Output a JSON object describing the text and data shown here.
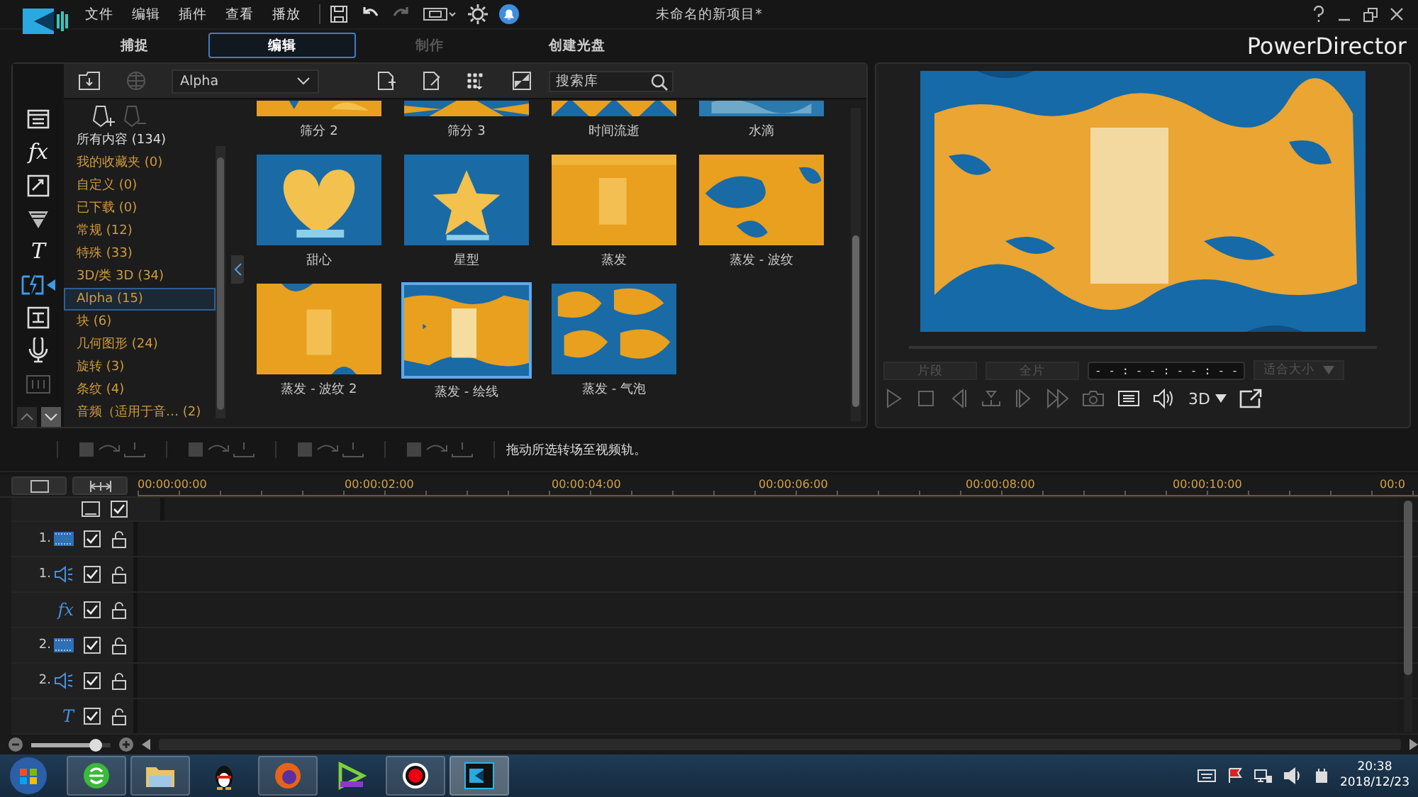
{
  "window": {
    "title": "未命名的新项目*",
    "app_name": "PowerDirector"
  },
  "menu": [
    "文件",
    "编辑",
    "插件",
    "查看",
    "播放"
  ],
  "mode_tabs": [
    {
      "label": "捕捉",
      "selected": false,
      "disabled": false
    },
    {
      "label": "编辑",
      "selected": true,
      "disabled": false
    },
    {
      "label": "制作",
      "selected": false,
      "disabled": true
    },
    {
      "label": "创建光盘",
      "selected": false,
      "disabled": false
    }
  ],
  "sidebar": [
    {
      "kind": "media",
      "selected": false
    },
    {
      "kind": "glyph",
      "glyph": "fx",
      "selected": false
    },
    {
      "kind": "pip",
      "selected": false
    },
    {
      "kind": "particle",
      "selected": false
    },
    {
      "kind": "glyph",
      "glyph": "T",
      "selected": false
    },
    {
      "kind": "transition",
      "selected": true
    },
    {
      "kind": "subtitle",
      "selected": false
    },
    {
      "kind": "mic",
      "selected": false
    },
    {
      "kind": "chapter",
      "selected": false
    }
  ],
  "library": {
    "category": "Alpha",
    "search": {
      "placeholder": "搜索库"
    },
    "categories": [
      {
        "label": "所有内容 (134)",
        "kind": "all",
        "selected": false
      },
      {
        "label": "我的收藏夹  (0)",
        "kind": "category",
        "selected": false
      },
      {
        "label": "自定义  (0)",
        "kind": "category",
        "selected": false
      },
      {
        "label": "已下载  (0)",
        "kind": "category",
        "selected": false
      },
      {
        "label": "常规  (12)",
        "kind": "category",
        "selected": false
      },
      {
        "label": "特殊  (33)",
        "kind": "category",
        "selected": false
      },
      {
        "label": "3D/类 3D  (34)",
        "kind": "category",
        "selected": false
      },
      {
        "label": "Alpha  (15)",
        "kind": "category",
        "selected": true
      },
      {
        "label": "块  (6)",
        "kind": "category",
        "selected": false
      },
      {
        "label": "几何图形  (24)",
        "kind": "category",
        "selected": false
      },
      {
        "label": "旋转  (3)",
        "kind": "category",
        "selected": false
      },
      {
        "label": "条纹  (4)",
        "kind": "category",
        "selected": false
      },
      {
        "label": "音频（适用于音…  (2)",
        "kind": "category",
        "selected": false
      }
    ],
    "items": [
      {
        "label": "筛分 2",
        "selected": false
      },
      {
        "label": "筛分 3",
        "selected": false
      },
      {
        "label": "时间流逝",
        "selected": false
      },
      {
        "label": "水滴",
        "selected": false
      },
      {
        "label": "甜心",
        "selected": false
      },
      {
        "label": "星型",
        "selected": false
      },
      {
        "label": "蒸发",
        "selected": false
      },
      {
        "label": "蒸发 - 波纹",
        "selected": false
      },
      {
        "label": "蒸发 - 波纹 2",
        "selected": false
      },
      {
        "label": "蒸发 - 绘线",
        "selected": true
      },
      {
        "label": "蒸发 - 气泡",
        "selected": false
      }
    ]
  },
  "preview": {
    "segments": [
      {
        "label": "片段",
        "disabled": true
      },
      {
        "label": "全片",
        "disabled": true
      }
    ],
    "timecode": "- - : - - : - - : - -",
    "zoom": {
      "label": "适合大小",
      "disabled": true
    },
    "mode_3d": "3D",
    "controls": [
      {
        "kind": "play",
        "disabled": true
      },
      {
        "kind": "stop",
        "disabled": true
      },
      {
        "kind": "prev",
        "disabled": true
      },
      {
        "kind": "split",
        "disabled": true
      },
      {
        "kind": "next",
        "disabled": true
      },
      {
        "kind": "forward",
        "disabled": true
      },
      {
        "kind": "camera",
        "disabled": true
      },
      {
        "kind": "subtitles",
        "disabled": false
      },
      {
        "kind": "volume",
        "disabled": false
      }
    ]
  },
  "hint": "拖动所选转场至视频轨。",
  "timeline": {
    "ticks": [
      "00:00:00:00",
      "00:00:02:00",
      "00:00:04:00",
      "00:00:06:00",
      "00:00:08:00",
      "00:00:10:00",
      "00:0"
    ],
    "tracks": [
      {
        "kind": "subtitle",
        "checked": true
      },
      {
        "kind": "video",
        "number": "1.",
        "checked": true,
        "locked": false
      },
      {
        "kind": "audio",
        "number": "1.",
        "checked": true,
        "locked": false
      },
      {
        "kind": "glyph",
        "glyph": "fx",
        "checked": true,
        "locked": false
      },
      {
        "kind": "video",
        "number": "2.",
        "checked": true,
        "locked": false
      },
      {
        "kind": "audio",
        "number": "2.",
        "checked": true,
        "locked": false
      },
      {
        "kind": "glyph",
        "glyph": "T",
        "checked": true,
        "locked": false
      }
    ],
    "zoom": {
      "level": 0.8
    }
  },
  "taskbar": {
    "time": "20:38",
    "date": "2018/12/23"
  }
}
